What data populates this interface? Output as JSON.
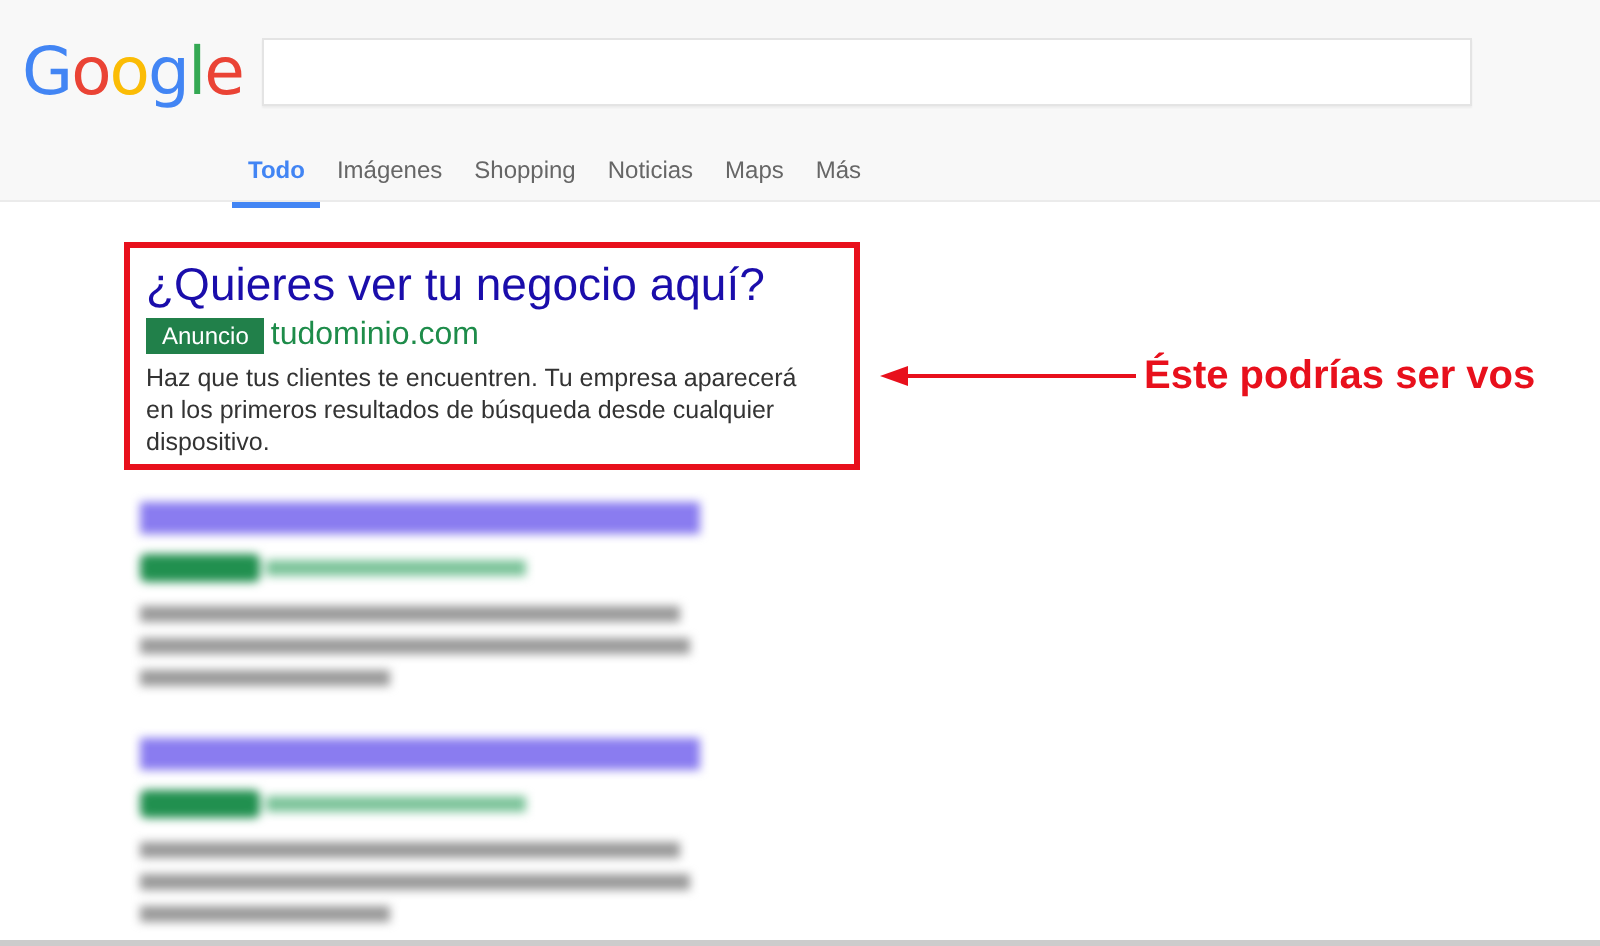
{
  "logo": "Google",
  "tabs": [
    {
      "label": "Todo",
      "selected": true
    },
    {
      "label": "Imágenes",
      "selected": false
    },
    {
      "label": "Shopping",
      "selected": false
    },
    {
      "label": "Noticias",
      "selected": false
    },
    {
      "label": "Maps",
      "selected": false
    },
    {
      "label": "Más",
      "selected": false
    }
  ],
  "ad": {
    "title": "¿Quieres ver tu negocio aquí?",
    "badge": "Anuncio",
    "url": "tudominio.com",
    "description": "Haz que tus clientes te encuentren. Tu empresa aparecerá en los primeros resultados de búsqueda desde cualquier dispositivo."
  },
  "callout": "Éste podrías ser vos",
  "blurred_results": [
    {
      "kind": "placeholder"
    },
    {
      "kind": "placeholder"
    }
  ]
}
